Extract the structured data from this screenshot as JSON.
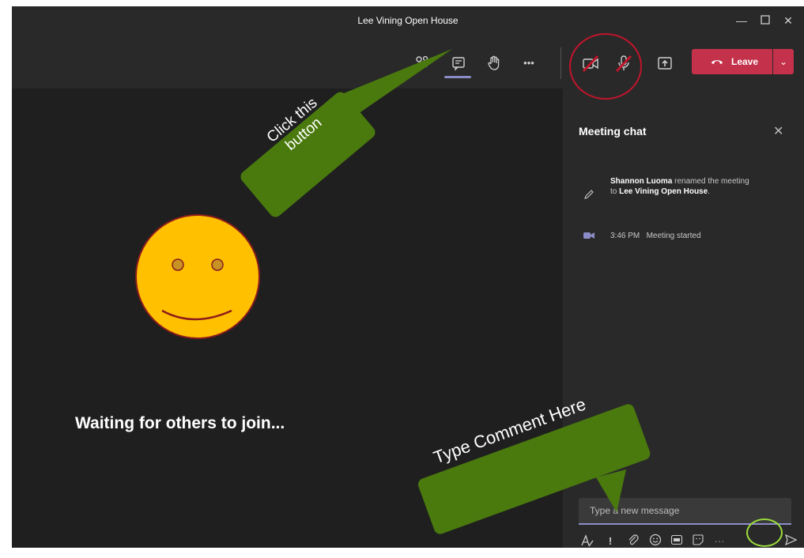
{
  "window": {
    "title": "Lee Vining Open House"
  },
  "toolbar": {
    "icons": [
      "participants-icon",
      "chat-icon",
      "raise-hand-icon",
      "more-icon",
      "camera-off-icon",
      "mic-off-icon",
      "share-icon"
    ],
    "more_label": "•••",
    "leave_label": "Leave",
    "leave_color": "#c4314b"
  },
  "stage": {
    "waiting_text": "Waiting for others to join..."
  },
  "chat": {
    "title": "Meeting chat",
    "events": [
      {
        "name": "Shannon Luoma",
        "text_before": "renamed the meeting to",
        "meeting": "Lee Vining Open House",
        "end": "."
      },
      {
        "time": "3:46 PM",
        "text": "Meeting started"
      }
    ],
    "input_placeholder": "Type a new message",
    "more_label": "···"
  },
  "annotations": {
    "click_callout": "Click this button",
    "click_line1": "Click this",
    "click_line2": "button",
    "type_callout": "Type Comment Here",
    "callout_color": "#4a7a0e",
    "ring_red": "#c0152b",
    "ring_green": "#9cdc3c"
  }
}
